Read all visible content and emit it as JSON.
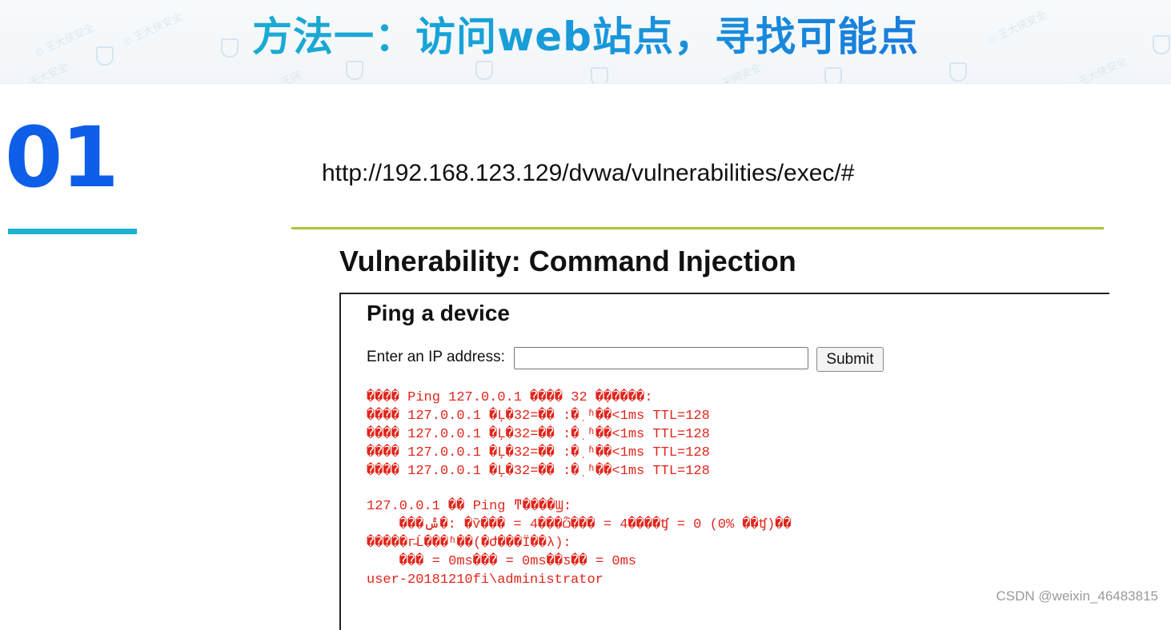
{
  "banner": {
    "title": "方法一：访问web站点，寻找可能点"
  },
  "section": {
    "number": "01"
  },
  "url": "http://192.168.123.129/dvwa/vulnerabilities/exec/#",
  "page": {
    "title": "Vulnerability: Command Injection",
    "panel_title": "Ping a device",
    "ip_label": "Enter an IP address:",
    "ip_value": "",
    "submit_label": "Submit"
  },
  "output": {
    "lines_top": [
      "���� Ping 127.0.0.1 ���� 32 �ֽ�����:",
      "���� 127.0.0.1 �Ļ�32=�� :�ֽ ʱ��<1ms TTL=128",
      "���� 127.0.0.1 �Ļ�32=�� :�ֽ ʱ��<1ms TTL=128",
      "���� 127.0.0.1 �Ļ�32=�� :�ֽ ʱ��<1ms TTL=128",
      "���� 127.0.0.1 �Ļ�32=�� :�ֽ ʱ��<1ms TTL=128"
    ],
    "lines_bottom": [
      "127.0.0.1 �� Ping ͳ����Ϣ:",
      "    ���ݰ�: �ѷ��� = 4���ѽ��� = 4����ʧ = 0 (0% ��ʧ)��",
      "�����г̵Ĺ���ʱ��(�Ժ���Ϊ��λ):",
      "    ��� = 0ms��� = 0ms��ƽ�� = 0ms",
      "user-20181210fi\\administrator"
    ]
  },
  "credit": "CSDN @weixin_46483815",
  "colors": {
    "title_gradient_start": "#1fb6c8",
    "title_gradient_end": "#1966e0",
    "number": "#0f5ee8",
    "number_underline": "#1cb1d0",
    "divider": "#a6c63a",
    "output_text": "#e0261c"
  }
}
